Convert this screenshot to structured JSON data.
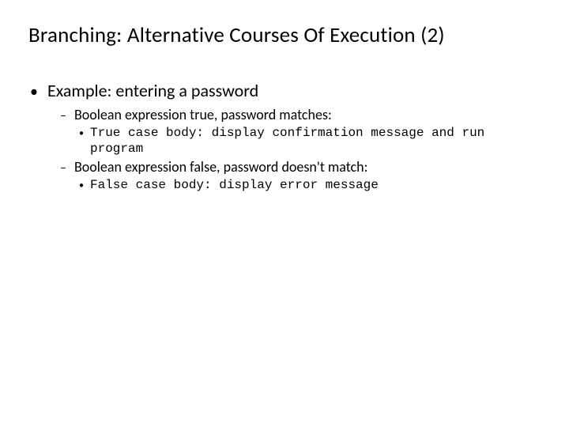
{
  "title": "Branching: Alternative Courses Of Execution (2)",
  "main_bullet": "Example: entering a password",
  "sub": {
    "a_label": "Boolean expression true, password matches:",
    "a_body": "True case body: display confirmation message and run program",
    "b_label": "Boolean expression false, password doesn't match:",
    "b_body": "False case body: display error message"
  }
}
